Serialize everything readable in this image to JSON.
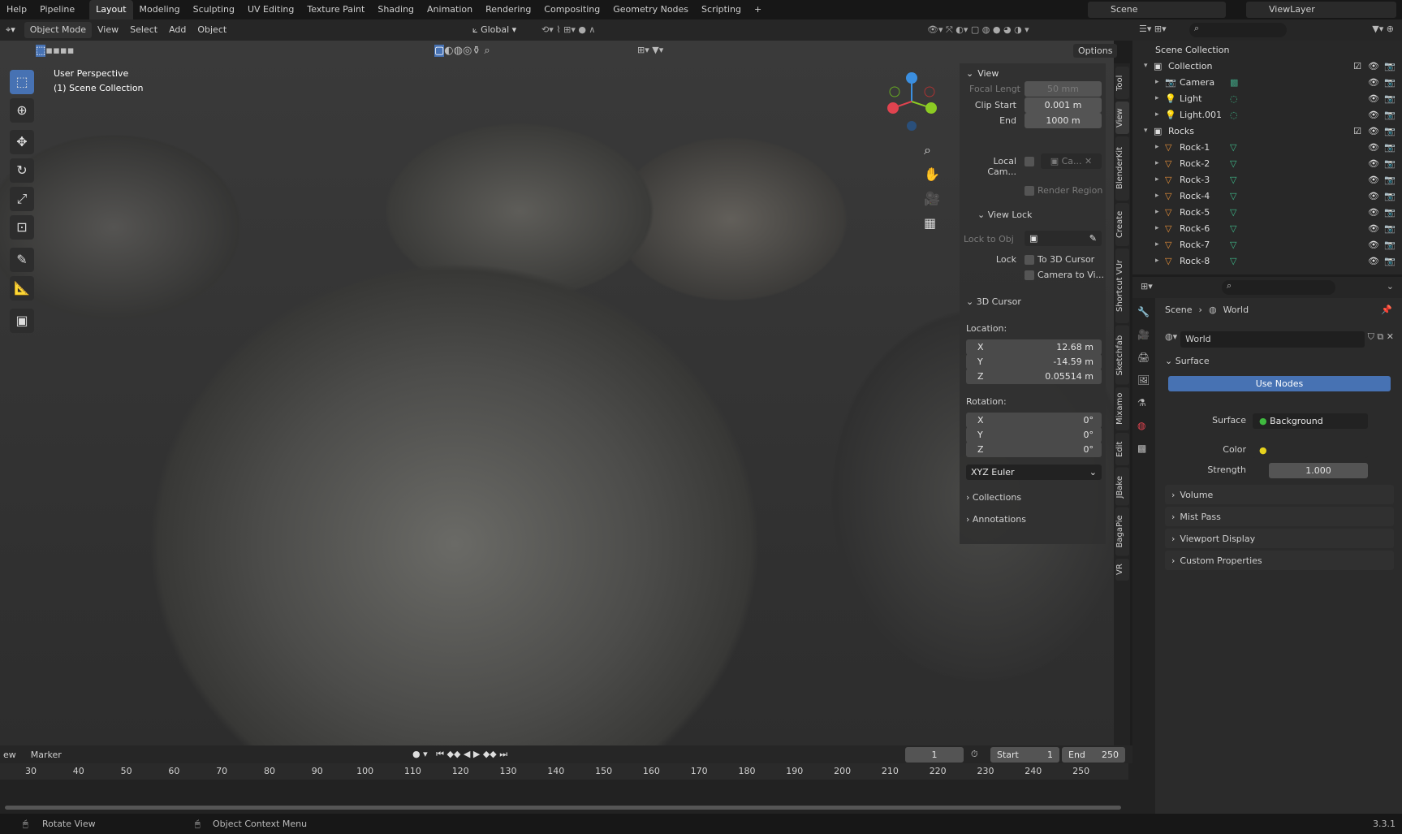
{
  "topbar": {
    "menus": [
      "Help",
      "Pipeline"
    ],
    "workspaces": [
      "Layout",
      "Modeling",
      "Sculpting",
      "UV Editing",
      "Texture Paint",
      "Shading",
      "Animation",
      "Rendering",
      "Compositing",
      "Geometry Nodes",
      "Scripting"
    ],
    "add": "+",
    "scene": "Scene",
    "viewlayer": "ViewLayer"
  },
  "header": {
    "mode": "Object Mode",
    "menus": [
      "View",
      "Select",
      "Add",
      "Object"
    ],
    "orientation": "Global",
    "options": "Options"
  },
  "viewport": {
    "view_name": "User Perspective",
    "collection": "(1) Scene Collection"
  },
  "npanel": {
    "view_title": "View",
    "focal_label": "Focal Lengt",
    "focal": "50 mm",
    "clip_start_label": "Clip Start",
    "clip_start": "0.001 m",
    "end_label": "End",
    "end": "1000 m",
    "local_cam_label": "Local Cam...",
    "local_cam": "Ca...",
    "render_region": "Render Region",
    "view_lock_title": "View Lock",
    "lock_obj_label": "Lock to Obj",
    "lock_label": "Lock",
    "to_cursor": "To 3D Cursor",
    "cam_to_view": "Camera to Vi...",
    "cursor_title": "3D Cursor",
    "location_label": "Location:",
    "loc": [
      {
        "a": "X",
        "v": "12.68 m"
      },
      {
        "a": "Y",
        "v": "-14.59 m"
      },
      {
        "a": "Z",
        "v": "0.05514 m"
      }
    ],
    "rotation_label": "Rotation:",
    "rot": [
      {
        "a": "X",
        "v": "0°"
      },
      {
        "a": "Y",
        "v": "0°"
      },
      {
        "a": "Z",
        "v": "0°"
      }
    ],
    "rot_mode": "XYZ Euler",
    "collections": "Collections",
    "annotations": "Annotations"
  },
  "side_tabs": [
    "Tool",
    "View",
    "BlenderKit",
    "Create",
    "Shortcut VUr",
    "Sketchfab",
    "Mixamo",
    "Edit",
    "JBake",
    "BagaPie",
    "VR"
  ],
  "outliner": {
    "root": "Scene Collection",
    "items": [
      {
        "name": "Collection",
        "depth": 0,
        "type": "collection"
      },
      {
        "name": "Camera",
        "depth": 1,
        "type": "camera"
      },
      {
        "name": "Light",
        "depth": 1,
        "type": "light"
      },
      {
        "name": "Light.001",
        "depth": 1,
        "type": "light"
      },
      {
        "name": "Rocks",
        "depth": 0,
        "type": "collection"
      },
      {
        "name": "Rock-1",
        "depth": 1,
        "type": "mesh"
      },
      {
        "name": "Rock-2",
        "depth": 1,
        "type": "mesh"
      },
      {
        "name": "Rock-3",
        "depth": 1,
        "type": "mesh"
      },
      {
        "name": "Rock-4",
        "depth": 1,
        "type": "mesh"
      },
      {
        "name": "Rock-5",
        "depth": 1,
        "type": "mesh"
      },
      {
        "name": "Rock-6",
        "depth": 1,
        "type": "mesh"
      },
      {
        "name": "Rock-7",
        "depth": 1,
        "type": "mesh"
      },
      {
        "name": "Rock-8",
        "depth": 1,
        "type": "mesh"
      }
    ]
  },
  "properties": {
    "breadcrumb": [
      "Scene",
      "World"
    ],
    "world": "World",
    "surface_title": "Surface",
    "use_nodes": "Use Nodes",
    "surface_label": "Surface",
    "surface": "Background",
    "color_label": "Color",
    "strength_label": "Strength",
    "strength": "1.000",
    "sections": [
      "Volume",
      "Mist Pass",
      "Viewport Display",
      "Custom Properties"
    ]
  },
  "timeline": {
    "view": "ew",
    "marker": "Marker",
    "frame": "1",
    "start_label": "Start",
    "start": "1",
    "end_label": "End",
    "end": "250",
    "ticks": [
      "30",
      "40",
      "50",
      "60",
      "70",
      "80",
      "90",
      "100",
      "110",
      "120",
      "130",
      "140",
      "150",
      "160",
      "170",
      "180",
      "190",
      "200",
      "210",
      "220",
      "230",
      "240",
      "250"
    ]
  },
  "status": {
    "left": "Rotate View",
    "mid": "Object Context Menu",
    "version": "3.3.1"
  },
  "colors": {
    "accent": "#4772b3",
    "x": "#e0434f",
    "y": "#8ccb23",
    "z": "#3b8fe0"
  }
}
